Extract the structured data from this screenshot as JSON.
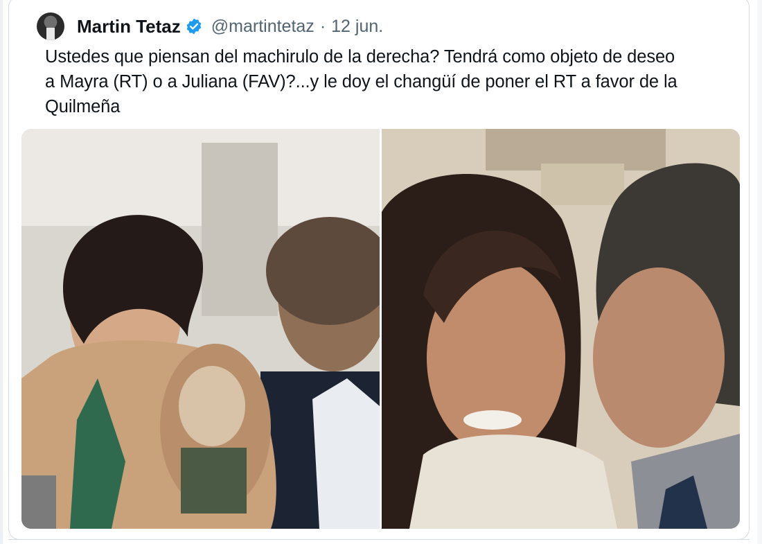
{
  "tweet": {
    "author_name": "Martin Tetaz",
    "handle": "@martintetaz",
    "separator": "·",
    "date": "12 jun.",
    "text_lines": [
      "Ustedes que piensan del machirulo de la derecha? Tendrá como objeto de deseo",
      "a Mayra (RT) o a Juliana (FAV)?...y le doy el changüí de poner el RT a favor de la",
      "Quilmeña"
    ],
    "verified_icon": "verified-badge-icon",
    "colors": {
      "verified": "#1d9bf0",
      "handle": "#536471",
      "text": "#0f1419",
      "border": "#d4dbe0"
    }
  },
  "media": [
    {
      "name": "photo-left"
    },
    {
      "name": "photo-right"
    }
  ]
}
